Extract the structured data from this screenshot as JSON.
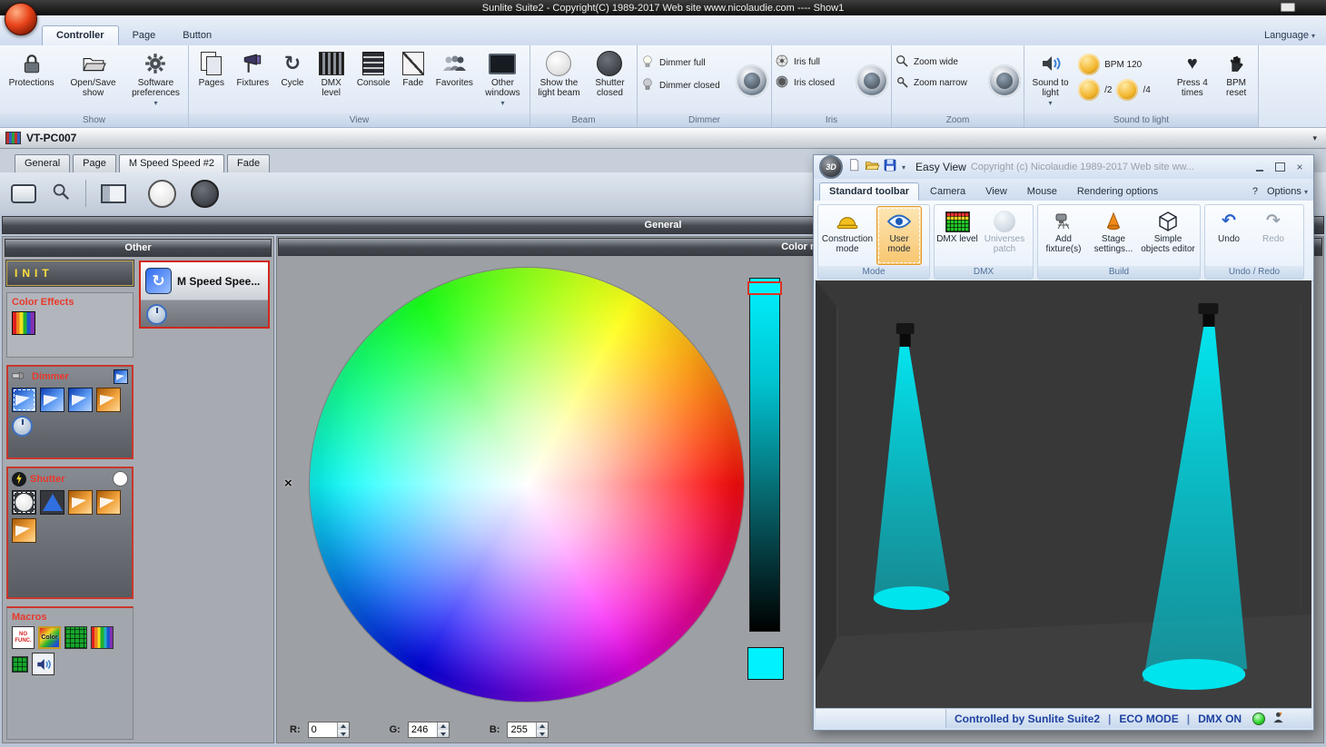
{
  "titlebar": {
    "title": "Sunlite Suite2 - Copyright(C) 1989-2017    Web site www.nicolaudie.com ---- Show1"
  },
  "ribbon": {
    "tabs": [
      "Controller",
      "Page",
      "Button"
    ],
    "language": "Language",
    "show": {
      "caption": "Show",
      "protections": "Protections",
      "open_save": "Open/Save show",
      "prefs": "Software preferences"
    },
    "view": {
      "caption": "View",
      "pages": "Pages",
      "fixtures": "Fixtures",
      "cycle": "Cycle",
      "dmx_level": "DMX level",
      "console": "Console",
      "fade": "Fade",
      "favorites": "Favorites",
      "other_windows": "Other windows"
    },
    "beam": {
      "caption": "Beam",
      "show_beam": "Show the light beam",
      "shutter_closed": "Shutter closed"
    },
    "dimmer": {
      "caption": "Dimmer",
      "full": "Dimmer full",
      "closed": "Dimmer closed"
    },
    "iris": {
      "caption": "Iris",
      "full": "Iris full",
      "closed": "Iris closed"
    },
    "zoom": {
      "caption": "Zoom",
      "wide": "Zoom wide",
      "narrow": "Zoom narrow"
    },
    "sound": {
      "caption": "Sound to light",
      "button": "Sound to light",
      "bpm": "BPM 120",
      "div2": "/2",
      "div4": "/4",
      "press4": "Press 4 times",
      "reset": "BPM reset"
    }
  },
  "pcbar": {
    "name": "VT-PC007"
  },
  "doc_tabs": [
    "General",
    "Page",
    "M Speed Speed #2",
    "Fade"
  ],
  "general_header": "General",
  "left_panel": {
    "header": "Other",
    "init": "INIT",
    "color_effects": "Color Effects",
    "dimmer": "Dimmer",
    "shutter": "Shutter",
    "macros": "Macros",
    "no_func": "NO FUNC.",
    "color_macro": "Color"
  },
  "speed_button": {
    "label": "M Speed Spee..."
  },
  "color_panel": {
    "header": "Color m",
    "r_label": "R:",
    "r_value": "0",
    "g_label": "G:",
    "g_value": "246",
    "b_label": "B:",
    "b_value": "255"
  },
  "easy_view": {
    "logo": "3D",
    "title": "Easy View",
    "subtitle": "Copyright (c) Nicolaudie 1989-2017    Web site ww...",
    "tabs": [
      "Standard toolbar",
      "Camera",
      "View",
      "Mouse",
      "Rendering options"
    ],
    "help": "?",
    "options": "Options",
    "construction": "Construction mode",
    "user_mode": "User mode",
    "dmx_level": "DMX level",
    "universes": "Universes patch",
    "add_fixtures": "Add fixture(s)",
    "stage_settings": "Stage settings...",
    "simple_objects": "Simple objects editor",
    "undo": "Undo",
    "redo": "Redo",
    "captions": {
      "mode": "Mode",
      "dmx": "DMX",
      "build": "Build",
      "undo_redo": "Undo / Redo"
    },
    "status": {
      "controlled": "Controlled by Sunlite Suite2",
      "sep": "|",
      "eco": "ECO MODE",
      "dmx_on": "DMX ON"
    }
  },
  "icons": {
    "chevron_down": "▾",
    "close_x": "×",
    "cycle_arrow": "↻",
    "undo_arrow": "↶",
    "redo_arrow": "↷",
    "heart": "♥",
    "marker_x": "×"
  },
  "colors": {
    "picked": "#00f2ff",
    "beam": "#00e4ee",
    "accent_red": "#d0281c"
  }
}
